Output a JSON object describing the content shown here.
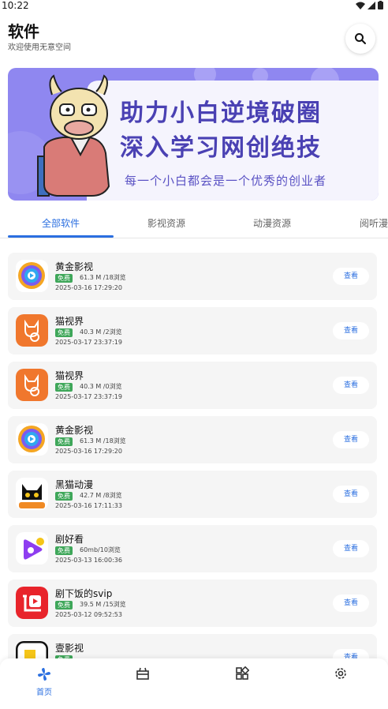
{
  "status_bar": {
    "time": "10:22"
  },
  "header": {
    "title": "软件",
    "subtitle": "欢迎使用无意空间"
  },
  "banner": {
    "line1": "助力小白逆境破圈",
    "line2": "深入学习网创绝技",
    "line3": "每一个小白都会是一个优秀的创业者"
  },
  "tabs": [
    {
      "label": "全部软件",
      "active": true
    },
    {
      "label": "影视资源",
      "active": false
    },
    {
      "label": "动漫资源",
      "active": false
    },
    {
      "label": "阅听漫",
      "active": false
    }
  ],
  "items": [
    {
      "name": "黄金影视",
      "badge": "免费",
      "stats": "61.3 M /18浏览",
      "date": "2025-03-16 17:29:20",
      "button": "查看",
      "icon": "golden-video-icon"
    },
    {
      "name": "猫视界",
      "badge": "免费",
      "stats": "40.3 M /2浏览",
      "date": "2025-03-17 23:37:19",
      "button": "查看",
      "icon": "cat-vision-icon"
    },
    {
      "name": "猫视界",
      "badge": "免费",
      "stats": "40.3 M /0浏览",
      "date": "2025-03-17 23:37:19",
      "button": "查看",
      "icon": "cat-vision-icon"
    },
    {
      "name": "黄金影视",
      "badge": "免费",
      "stats": "61.3 M /18浏览",
      "date": "2025-03-16 17:29:20",
      "button": "查看",
      "icon": "golden-video-icon"
    },
    {
      "name": "黑猫动漫",
      "badge": "免费",
      "stats": "42.7 M /8浏览",
      "date": "2025-03-16 17:11:33",
      "button": "查看",
      "icon": "black-cat-anime-icon"
    },
    {
      "name": "剧好看",
      "badge": "免费",
      "stats": "60mb/10浏览",
      "date": "2025-03-13 16:00:36",
      "button": "查看",
      "icon": "drama-good-icon"
    },
    {
      "name": "剧下饭的svip",
      "badge": "免费",
      "stats": "39.5 M /15浏览",
      "date": "2025-03-12 09:52:53",
      "button": "查看",
      "icon": "drama-catchup-icon"
    },
    {
      "name": "壹影视",
      "badge": "免费",
      "stats": "",
      "date": "",
      "button": "查看",
      "icon": "one-video-icon"
    }
  ],
  "bottom_nav": [
    {
      "label": "首页",
      "icon": "pinwheel-home-icon",
      "active": true
    },
    {
      "label": "",
      "icon": "gift-box-icon",
      "active": false
    },
    {
      "label": "",
      "icon": "apps-grid-icon",
      "active": false
    },
    {
      "label": "",
      "icon": "gear-icon",
      "active": false
    }
  ],
  "colors": {
    "accent": "#2b6fe0",
    "badge": "#3fa75a",
    "banner": "#8f87f0"
  }
}
